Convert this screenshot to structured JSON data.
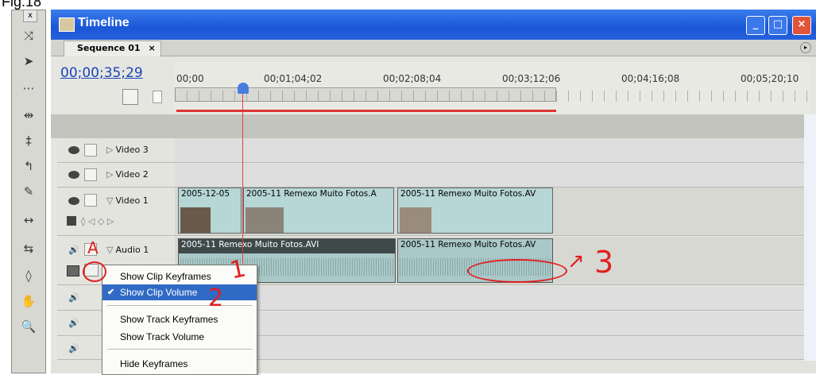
{
  "caption": "Fig.18",
  "window": {
    "title": "Timeline",
    "minimize_glyph": "_",
    "maximize_glyph": "□",
    "close_glyph": "×"
  },
  "tabs": [
    {
      "label": "Sequence 01",
      "close": "×"
    }
  ],
  "panel_menu_glyph": "▸",
  "timecode": "00;00;35;29",
  "ruler": {
    "labels": [
      "00;00",
      "00;01;04;02",
      "00;02;08;04",
      "00;03;12;06",
      "00;04;16;08",
      "00;05;20;10"
    ]
  },
  "tools": [
    {
      "name": "track-select-tool",
      "glyph": "⤨"
    },
    {
      "name": "selection-tool",
      "glyph": "➤"
    },
    {
      "name": "track-select-tool-2",
      "glyph": "⋯"
    },
    {
      "name": "ripple-edit-tool",
      "glyph": "⇹"
    },
    {
      "name": "rolling-edit-tool",
      "glyph": "‡"
    },
    {
      "name": "rate-stretch-tool",
      "glyph": "↰"
    },
    {
      "name": "razor-tool",
      "glyph": "✎"
    },
    {
      "name": "slip-tool",
      "glyph": "↔"
    },
    {
      "name": "slide-tool",
      "glyph": "⇆"
    },
    {
      "name": "pen-tool",
      "glyph": "◊"
    },
    {
      "name": "hand-tool",
      "glyph": "✋"
    },
    {
      "name": "zoom-tool",
      "glyph": "🔍"
    }
  ],
  "tracks": {
    "video3": {
      "label": "Video 3"
    },
    "video2": {
      "label": "Video 2"
    },
    "video1": {
      "label": "Video 1"
    },
    "audio1": {
      "label": "Audio 1"
    }
  },
  "video_clips": [
    {
      "title": "2005-12-05"
    },
    {
      "title": "2005-11 Remexo Muito Fotos.A"
    },
    {
      "title": "2005-11 Remexo Muito Fotos.AV"
    }
  ],
  "audio_clips": [
    {
      "title": "2005-11 Remexo Muito Fotos.AVI"
    },
    {
      "title": "2005-11 Remexo Muito Fotos.AV"
    }
  ],
  "context_menu": {
    "items": [
      {
        "label": "Show Clip Keyframes",
        "selected": false,
        "checked": false
      },
      {
        "label": "Show Clip Volume",
        "selected": true,
        "checked": true
      },
      {
        "label": "Show Track Keyframes",
        "selected": false,
        "checked": false
      },
      {
        "label": "Show Track Volume",
        "selected": false,
        "checked": false
      },
      {
        "label": "Hide Keyframes",
        "selected": false,
        "checked": false
      }
    ],
    "check_glyph": "✔"
  },
  "annotations": {
    "a": "A",
    "one": "1",
    "two": "2",
    "three": "3"
  },
  "colors": {
    "titlebar": "#1b57d6",
    "clip": "#b7d6d6",
    "menu_selected": "#316ac5",
    "annotation": "#e02020",
    "playhead": "#e04040"
  }
}
